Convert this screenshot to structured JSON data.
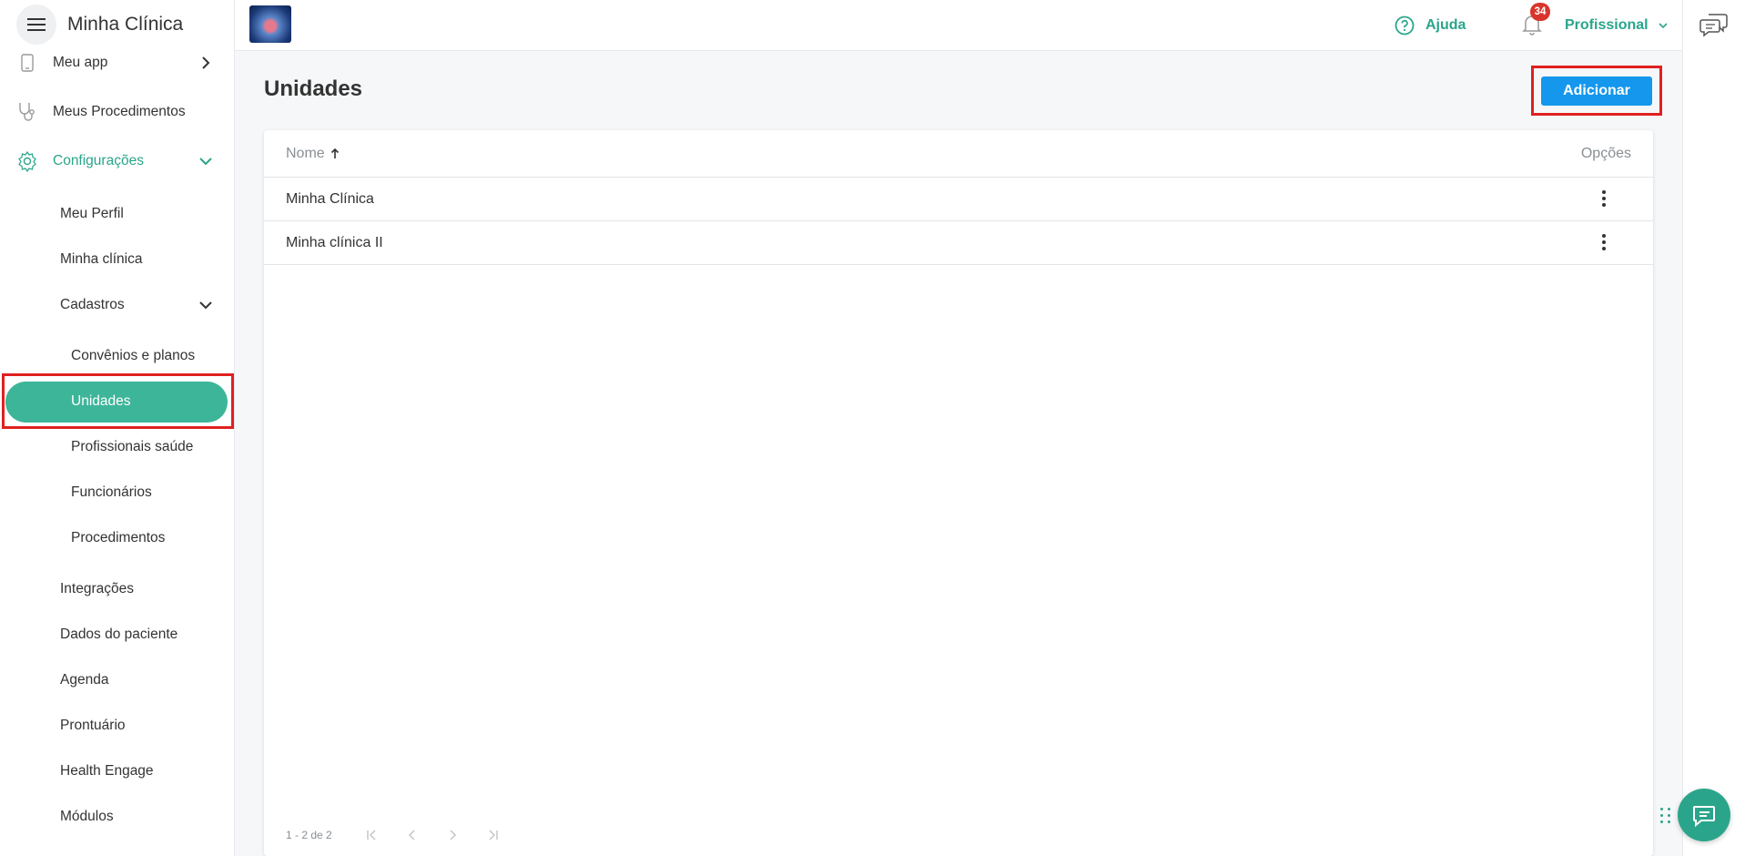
{
  "app": {
    "title": "Minha Clínica"
  },
  "sidebar": {
    "items": [
      {
        "label": "Meu app",
        "icon": "phone-icon"
      },
      {
        "label": "Meus Procedimentos",
        "icon": "stethoscope-icon"
      },
      {
        "label": "Configurações",
        "icon": "gear-icon",
        "expanded": true
      }
    ],
    "config_items": [
      "Meu Perfil",
      "Minha clínica",
      "Cadastros"
    ],
    "cadastros_items": [
      "Convênios e planos",
      "Unidades",
      "Profissionais saúde",
      "Funcionários",
      "Procedimentos"
    ],
    "more_items": [
      "Integrações",
      "Dados do paciente",
      "Agenda",
      "Prontuário",
      "Health Engage",
      "Módulos"
    ],
    "active": "Unidades"
  },
  "topbar": {
    "help_label": "Ajuda",
    "notifications_count": "34",
    "profile_label": "Profissional"
  },
  "main": {
    "title": "Unidades",
    "add_label": "Adicionar",
    "table": {
      "col_name": "Nome",
      "col_options": "Opções",
      "rows": [
        "Minha Clínica",
        "Minha clínica II"
      ]
    },
    "pagination": "1 - 2 de 2"
  },
  "colors": {
    "accent": "#2aa58b",
    "primary_button": "#1497ec",
    "highlight": "#e02020",
    "badge": "#d9342b"
  }
}
